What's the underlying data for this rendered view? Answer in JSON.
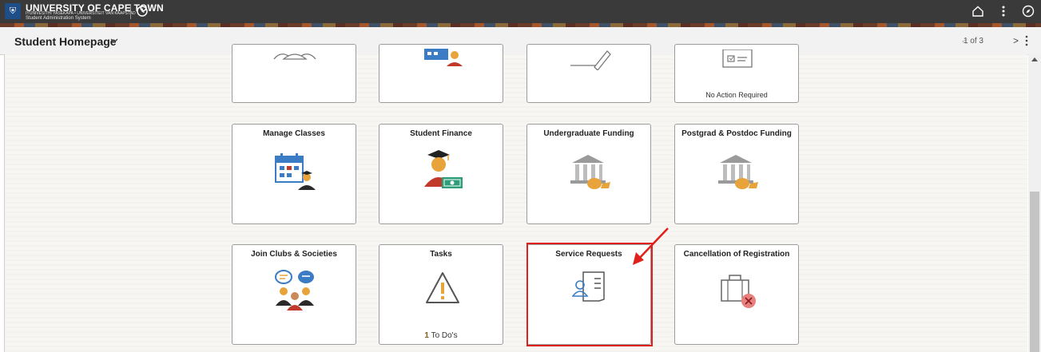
{
  "topbar": {
    "university_name": "UNIVERSITY OF CAPE TOWN",
    "university_subtitle": "IYUNIVESITHI YASEKAPA • UNIVERSITEIT VAN KAAPSTAD",
    "system_name": "Student Administration System",
    "icons": [
      "recent-history-icon",
      "home-icon",
      "more-options-icon",
      "navbar-compass-icon"
    ]
  },
  "header": {
    "title": "Student Homepage",
    "pager": "1 of 3",
    "prev_icon": "<",
    "next_icon": ">"
  },
  "tiles": {
    "row0": [
      {
        "title": "",
        "footer": "",
        "icon": "people-group-icon"
      },
      {
        "title": "",
        "footer": "",
        "icon": "calendar-student-icon"
      },
      {
        "title": "",
        "footer": "",
        "icon": "pencil-icon"
      },
      {
        "title": "",
        "footer": "No Action Required",
        "icon": "checklist-icon"
      }
    ],
    "row1": [
      {
        "title": "Manage Classes",
        "icon": "calendar-student-icon"
      },
      {
        "title": "Student Finance",
        "icon": "graduate-money-icon"
      },
      {
        "title": "Undergraduate Funding",
        "icon": "bank-moneybag-icon"
      },
      {
        "title": "Postgrad & Postdoc Funding",
        "icon": "bank-moneybag-icon"
      }
    ],
    "row2": [
      {
        "title": "Join Clubs & Societies",
        "icon": "people-chat-icon"
      },
      {
        "title": "Tasks",
        "footer_count": "1",
        "footer_label": "To Do's",
        "icon": "warning-icon"
      },
      {
        "title": "Service Requests",
        "icon": "request-document-icon"
      },
      {
        "title": "Cancellation of Registration",
        "icon": "briefcase-cancel-icon"
      }
    ]
  },
  "colors": {
    "topbar": "#3a3a3a",
    "highlight": "#e0201a",
    "accent_orange": "#e8a33a",
    "accent_blue": "#3b7cc4"
  }
}
